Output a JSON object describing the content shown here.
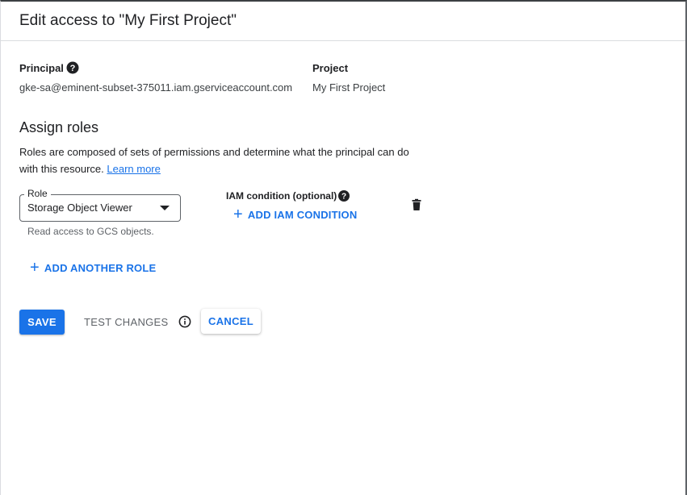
{
  "dialog": {
    "title": "Edit access to \"My First Project\""
  },
  "principal": {
    "label": "Principal",
    "value": "gke-sa@eminent-subset-375011.iam.gserviceaccount.com",
    "help_icon": "help-circle-icon"
  },
  "project": {
    "label": "Project",
    "value": "My First Project"
  },
  "assign_roles": {
    "title": "Assign roles",
    "description": "Roles are composed of sets of permissions and determine what the principal can do with this resource.",
    "learn_more": "Learn more"
  },
  "role": {
    "label": "Role",
    "selected": "Storage Object Viewer",
    "hint": "Read access to GCS objects.",
    "dropdown_icon": "caret-down-icon",
    "delete_icon": "trash-icon"
  },
  "iam_condition": {
    "label": "IAM condition (optional)",
    "help_icon": "help-circle-icon",
    "add_label": "ADD IAM CONDITION"
  },
  "add_another_role": "ADD ANOTHER ROLE",
  "actions": {
    "save": "SAVE",
    "test_changes": "TEST CHANGES",
    "info_icon": "info-icon",
    "cancel": "CANCEL"
  },
  "colors": {
    "accent": "#1a73e8",
    "text": "#202124",
    "muted": "#5f6368"
  }
}
